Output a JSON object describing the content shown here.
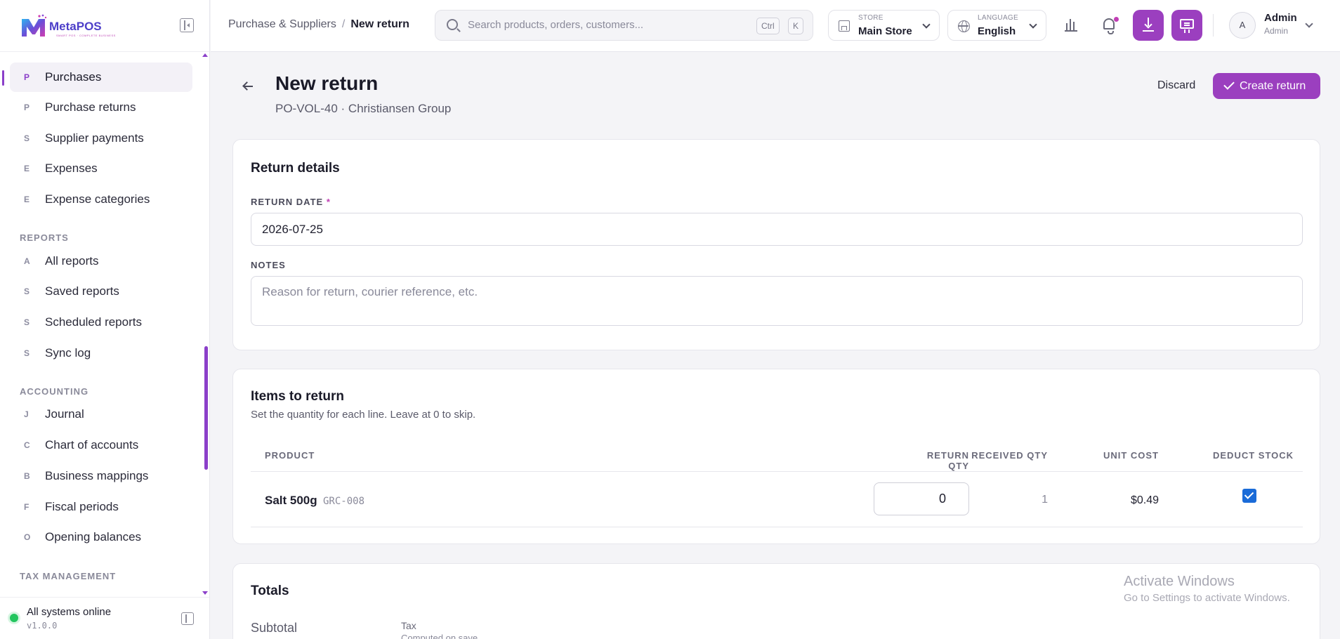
{
  "app": {
    "logo_text": "MetaPOS",
    "logo_tagline": "SMART POS · COMPLETE BUSINESS"
  },
  "sidebar": {
    "items": [
      {
        "letter": "P",
        "label": "Purchases",
        "active": true
      },
      {
        "letter": "P",
        "label": "Purchase returns"
      },
      {
        "letter": "S",
        "label": "Supplier payments"
      },
      {
        "letter": "E",
        "label": "Expenses"
      },
      {
        "letter": "E",
        "label": "Expense categories"
      }
    ],
    "reports_heading": "REPORTS",
    "reports": [
      {
        "letter": "A",
        "label": "All reports"
      },
      {
        "letter": "S",
        "label": "Saved reports"
      },
      {
        "letter": "S",
        "label": "Scheduled reports"
      },
      {
        "letter": "S",
        "label": "Sync log"
      }
    ],
    "accounting_heading": "ACCOUNTING",
    "accounting": [
      {
        "letter": "J",
        "label": "Journal"
      },
      {
        "letter": "C",
        "label": "Chart of accounts"
      },
      {
        "letter": "B",
        "label": "Business mappings"
      },
      {
        "letter": "F",
        "label": "Fiscal periods"
      },
      {
        "letter": "O",
        "label": "Opening balances"
      }
    ],
    "tax_heading": "TAX MANAGEMENT",
    "status": "All systems online",
    "version": "v1.0.0"
  },
  "topbar": {
    "breadcrumb_parent": "Purchase & Suppliers",
    "breadcrumb_sep": "/",
    "breadcrumb_current": "New return",
    "search_placeholder": "Search products, orders, customers...",
    "kbd_ctrl": "Ctrl",
    "kbd_k": "K",
    "store_label": "STORE",
    "store_value": "Main Store",
    "language_label": "LANGUAGE",
    "language_value": "English",
    "user_initial": "A",
    "user_name": "Admin",
    "user_role": "Admin"
  },
  "page": {
    "title": "New return",
    "subtitle": "PO-VOL-40 · Christiansen Group",
    "discard_label": "Discard",
    "create_label": "Create return"
  },
  "return_details": {
    "title": "Return details",
    "date_label": "RETURN DATE",
    "date_required": "*",
    "date_value": "2026-07-25",
    "notes_label": "NOTES",
    "notes_placeholder": "Reason for return, courier reference, etc."
  },
  "items": {
    "title": "Items to return",
    "description": "Set the quantity for each line. Leave at 0 to skip.",
    "columns": {
      "product": "PRODUCT",
      "received": "RECEIVED QTY",
      "return": "RETURN QTY",
      "unit_cost": "UNIT COST",
      "deduct": "DEDUCT STOCK"
    },
    "rows": [
      {
        "name": "Salt 500g",
        "sku": "GRC-008",
        "received": "1",
        "return_qty": "0",
        "unit_cost": "$0.49",
        "deduct": true
      }
    ]
  },
  "totals": {
    "title": "Totals",
    "subtotal_label": "Subtotal",
    "tax_label": "Tax",
    "tax_note": "Computed on save"
  },
  "watermark": {
    "title": "Activate Windows",
    "subtitle": "Go to Settings to activate Windows."
  },
  "colors": {
    "brand": "#9b3fbf",
    "status_online": "#22c55e",
    "checkbox": "#1a6bd8"
  }
}
